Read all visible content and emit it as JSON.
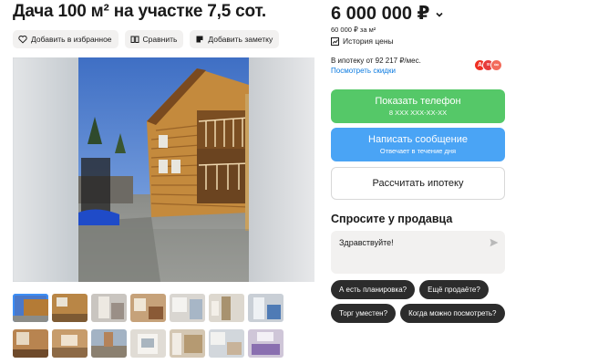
{
  "listing": {
    "title": "Дача 100 м² на участке 7,5 сот."
  },
  "actions": {
    "favorite": "Добавить в избранное",
    "compare": "Сравнить",
    "note": "Добавить заметку"
  },
  "pricing": {
    "price": "6 000 000 ₽",
    "per_meter": "60 000 ₽ за м²",
    "history": "История цены",
    "mortgage": "В ипотеку от 92 217 ₽/мес.",
    "discounts": "Посмотреть скидки"
  },
  "buttons": {
    "phone_label": "Показать телефон",
    "phone_sub": "8 XXX XXX-XX-XX",
    "message_label": "Написать сообщение",
    "message_sub": "Отвечает в течение дня",
    "calc_label": "Рассчитать ипотеку"
  },
  "seller_chat": {
    "heading": "Спросите у продавца",
    "message_text": "Здравствуйте!",
    "quick_questions": [
      "А есть планировка?",
      "Ещё продаёте?",
      "Торг уместен?",
      "Когда можно посмотреть?"
    ]
  },
  "colors": {
    "phone_button": "#55c868",
    "message_button": "#4aa4f5",
    "link": "#0a7ae0",
    "chip": "#2c2c2c"
  },
  "icons": {
    "favorite": "heart-icon",
    "compare": "compare-icon",
    "note": "note-icon",
    "history": "chart-icon",
    "send": "send-icon",
    "price_menu": "chevron-down-icon"
  }
}
